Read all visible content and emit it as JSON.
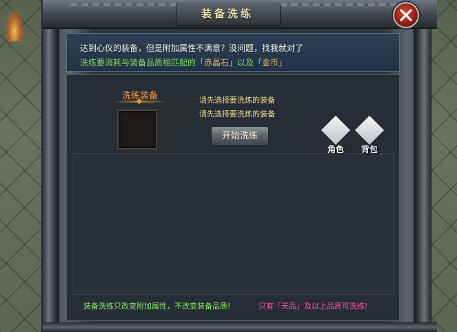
{
  "window": {
    "title": "装备洗练",
    "close_icon": "close-x-icon"
  },
  "info": {
    "line1": "达到心仪的装备，但是附加属性不满意？没问题，找我就对了",
    "line2_prefix": "洗练要消耗与装备品质相匹配的",
    "line2_item1": "「赤晶石」",
    "line2_mid": "以及",
    "line2_item2": "「金币」"
  },
  "refine": {
    "slot_label": "洗练装备",
    "hint1": "请先选择要洗炼的装备",
    "hint2": "请先选择要洗炼的装备",
    "start_button": "开始洗练"
  },
  "quick_tabs": [
    {
      "label": "角色",
      "icon": "character-icon"
    },
    {
      "label": "背包",
      "icon": "backpack-icon"
    }
  ],
  "footer": {
    "left": "装备洗练只改变附加属性，不改变装备品质!",
    "right": "只有「天品」及以上品质可洗练!"
  },
  "colors": {
    "accent_green": "#7fe05a",
    "accent_orange": "#ff9a3c",
    "hint_yellow": "#f2d98a",
    "footer_pink": "#ff4fa0",
    "close_red": "#c0281a"
  }
}
